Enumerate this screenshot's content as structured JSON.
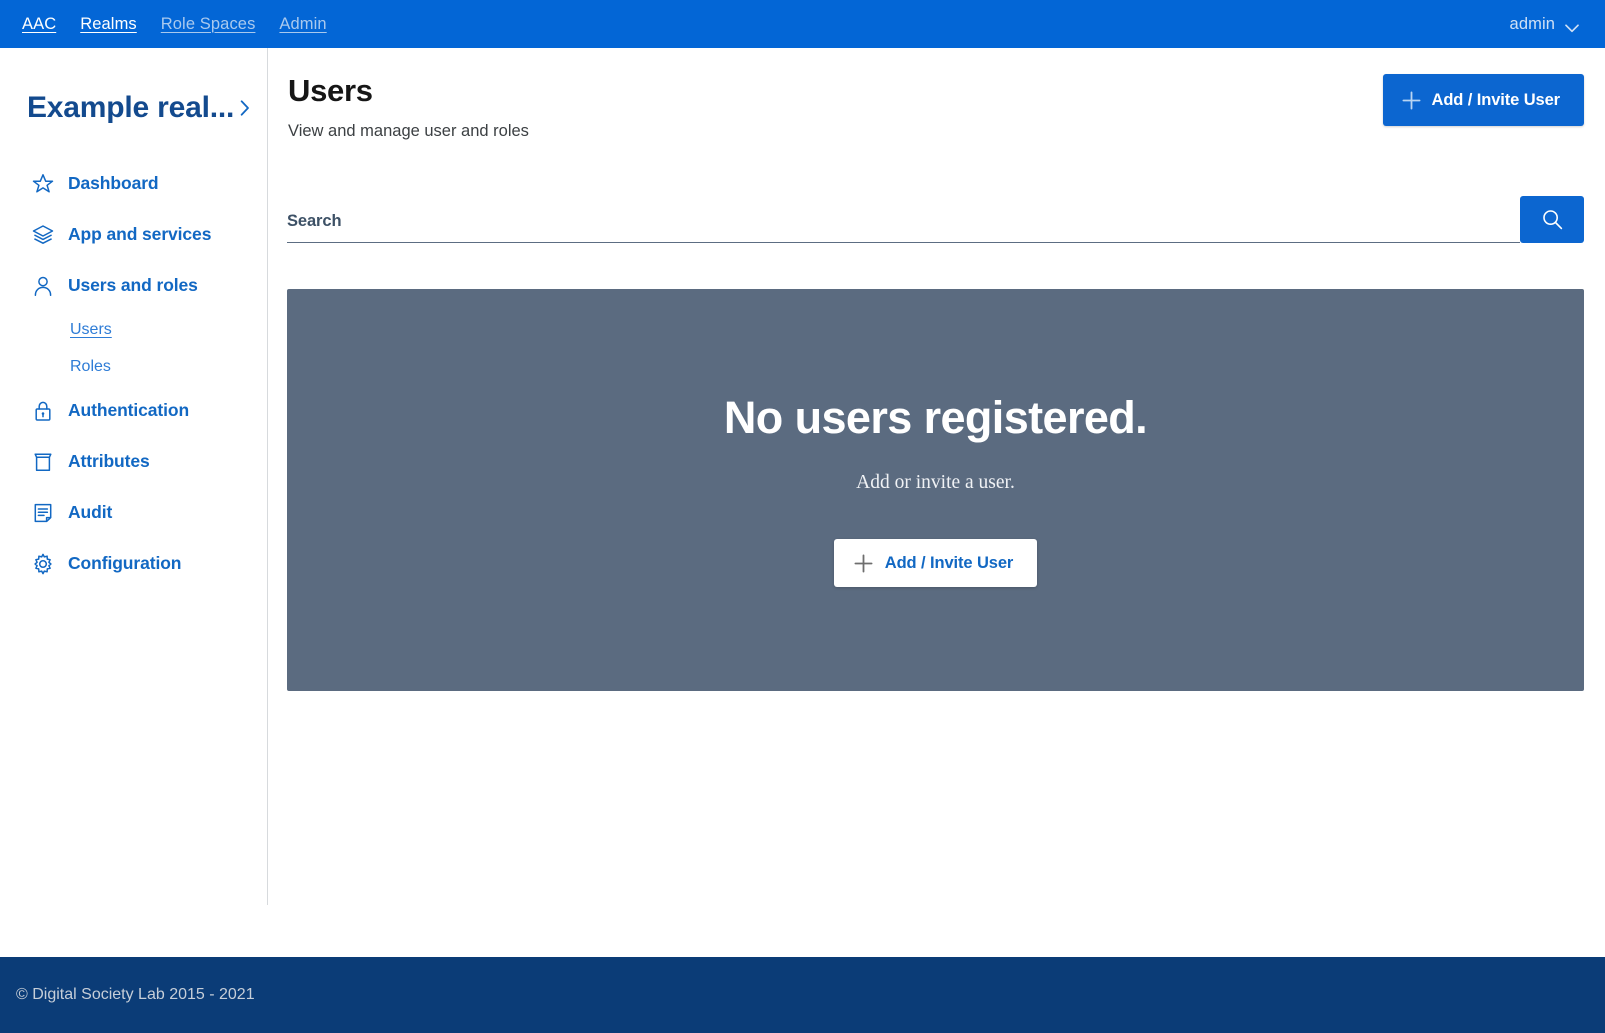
{
  "topnav": {
    "links": [
      {
        "label": "AAC",
        "state": "active"
      },
      {
        "label": "Realms",
        "state": "active"
      },
      {
        "label": "Role Spaces",
        "state": "dim"
      },
      {
        "label": "Admin",
        "state": "dim"
      }
    ],
    "user": {
      "name": "admin",
      "caret_icon": "chevron-down-icon"
    }
  },
  "sidebar": {
    "realm": {
      "title": "Example real...",
      "expand_icon": "chevron-right-icon"
    },
    "items": [
      {
        "label": "Dashboard",
        "icon": "star-icon"
      },
      {
        "label": "App and services",
        "icon": "layers-icon"
      },
      {
        "label": "Users and roles",
        "icon": "user-icon"
      },
      {
        "label": "Authentication",
        "icon": "lock-icon"
      },
      {
        "label": "Attributes",
        "icon": "archive-box-icon"
      },
      {
        "label": "Audit",
        "icon": "document-lines-icon"
      },
      {
        "label": "Configuration",
        "icon": "gear-icon"
      }
    ],
    "subitems": [
      {
        "label": "Users",
        "active": true
      },
      {
        "label": "Roles",
        "active": false
      }
    ]
  },
  "main": {
    "title": "Users",
    "subtitle": "View and manage user and roles",
    "add_button": {
      "label": "Add / Invite User",
      "icon": "plus-icon"
    },
    "search": {
      "placeholder": "Search",
      "value": "",
      "button_icon": "search-icon"
    },
    "empty_state": {
      "title": "No users registered.",
      "subtitle": "Add or invite a user.",
      "button": {
        "label": "Add / Invite User",
        "icon": "plus-icon"
      }
    }
  },
  "footer": {
    "text": "© Digital Society Lab 2015 - 2021"
  },
  "colors": {
    "nav_blue": "#0366d6",
    "accent_blue": "#0c66d0",
    "link_blue": "#1268c3",
    "realm_title": "#134a8e",
    "panel_slate": "#5b6b80",
    "footer_navy": "#0b3c77"
  }
}
